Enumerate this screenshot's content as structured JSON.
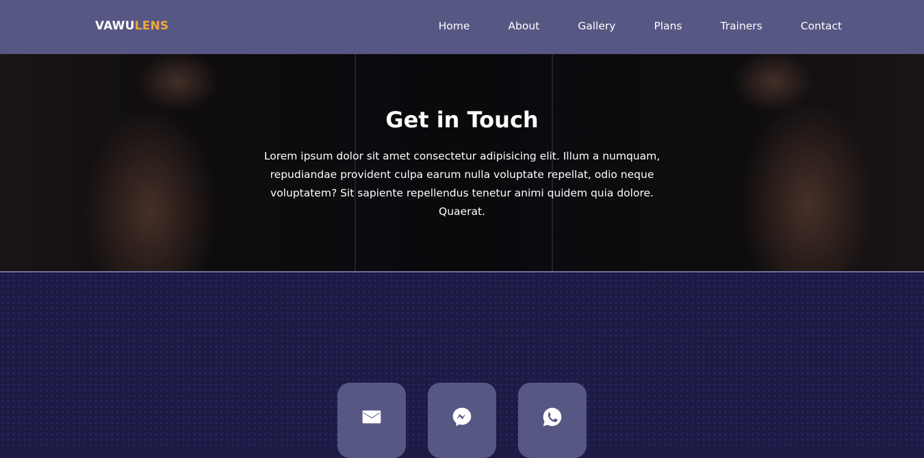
{
  "navbar": {
    "logo_part1": "VAWU",
    "logo_part2": "LENS",
    "links": [
      "Home",
      "About",
      "Gallery",
      "Plans",
      "Trainers",
      "Contact"
    ],
    "colors": {
      "background": "#575784",
      "logo_accent": "#f2a93b",
      "text": "#ffffff"
    }
  },
  "hero": {
    "title": "Get in Touch",
    "text": "Lorem ipsum dolor sit amet consectetur adipisicing elit. Illum a numquam, repudiandae provident culpa earum nulla voluptate repellat, odio neque voluptatem? Sit sapiente repellendus tenetur animi quidem quia dolore. Quaerat."
  },
  "contact": {
    "icons": [
      "email-icon",
      "messenger-icon",
      "whatsapp-icon"
    ],
    "colors": {
      "section_background": "#1d1a46",
      "button_background": "#575784"
    }
  }
}
